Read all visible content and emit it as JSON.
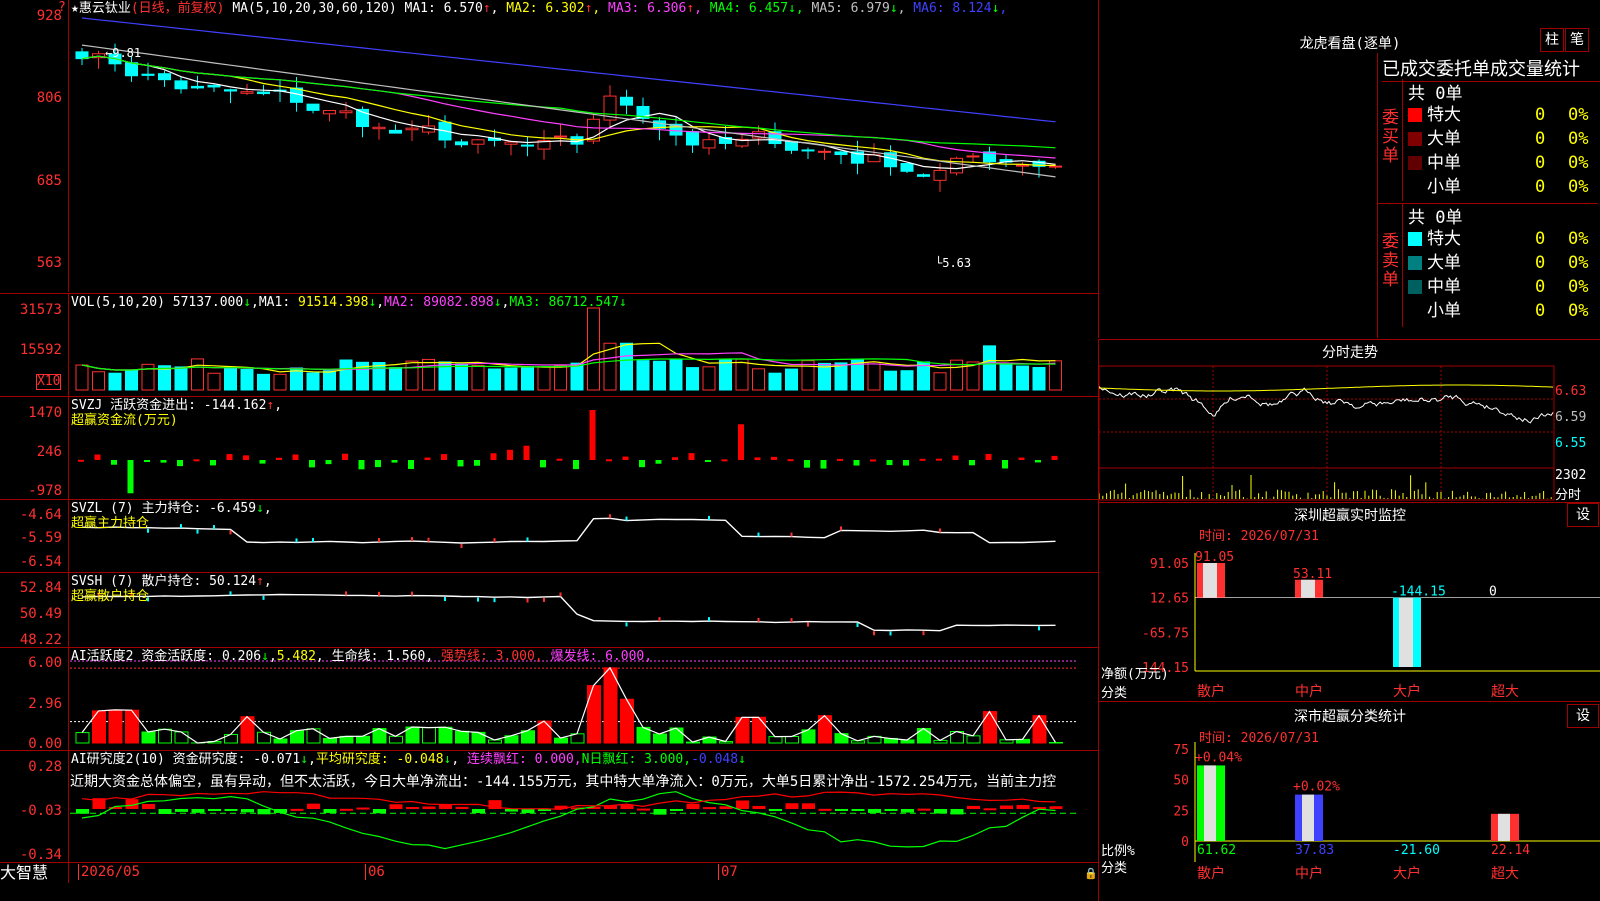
{
  "stock": {
    "name": "惠云钛业",
    "mode": "(日线，前复权)",
    "ma_label": "MA(5,10,20,30,60,120)",
    "ma": [
      {
        "name": "MA1",
        "value": "6.570",
        "arrow": "↑",
        "color": "#ffffff"
      },
      {
        "name": "MA2",
        "value": "6.302",
        "arrow": "↑",
        "color": "#ffff00"
      },
      {
        "name": "MA3",
        "value": "6.306",
        "arrow": "↑",
        "color": "#ff40ff"
      },
      {
        "name": "MA4",
        "value": "6.457",
        "arrow": "↓",
        "color": "#00ff00"
      },
      {
        "name": "MA5",
        "value": "6.979",
        "arrow": "↓",
        "color": "#c0c0c0"
      },
      {
        "name": "MA6",
        "value": "8.124",
        "arrow": "↓",
        "color": "#4040ff"
      }
    ],
    "price_axis": [
      "928",
      "806",
      "685",
      "563"
    ],
    "high_mark": "9.81",
    "low_mark": "5.63"
  },
  "vol": {
    "label": "VOL(5,10,20)",
    "value": "57137.000",
    "ma1": "91514.398",
    "ma2": "89082.898",
    "ma3": "86712.547",
    "axis": [
      "31573",
      "15592"
    ],
    "unit": "X10"
  },
  "svzj": {
    "label": "SVZJ  活跃资金进出:",
    "value": "-144.162",
    "sub": "超赢资金流(万元)",
    "axis": [
      "1470",
      "246",
      "-978"
    ]
  },
  "svzl": {
    "label": "SVZL (7) 主力持仓:",
    "value": "-6.459",
    "sub": "超赢主力持仓",
    "axis": [
      "-4.64",
      "-5.59",
      "-6.54"
    ]
  },
  "svsh": {
    "label": "SVSH (7) 散户持仓:",
    "value": "50.124",
    "sub": "超赢散户持仓",
    "axis": [
      "52.84",
      "50.49",
      "48.22"
    ]
  },
  "ai1": {
    "label": "AI活跃度2 资金活跃度:",
    "v1": "0.206",
    "v2": "5.482",
    "life": "生命线: 1.560,",
    "strong": "强势线: 3.000,",
    "burst": "爆发线: 6.000,",
    "axis": [
      "6.00",
      "2.96",
      "0.00"
    ]
  },
  "ai2": {
    "label": "AI研究度2(10) 资金研究度:",
    "v1": "-0.071",
    "avg": "平均研究度: -0.048",
    "lianxu": "连续飘红: 0.000,",
    "nday": "N日飘红: 3.000,",
    "last": "-0.048",
    "axis": [
      "0.28",
      "-0.03",
      "-0.34"
    ],
    "comment": "近期大资金总体偏空，虽有异动，但不太活跃，今日大单净流出：-144.155万元，其中特大单净流入：0万元，大单5日累计净出-1572.254万元，当前主力控"
  },
  "footer": {
    "brand": "大智慧",
    "dates": [
      "2026/05",
      "06",
      "07"
    ]
  },
  "longhu": {
    "title": "龙虎看盘(逐单)",
    "btn1": "柱",
    "btn2": "笔",
    "header": "已成交委托单成交量统计",
    "buy": {
      "side": "委买单",
      "total": "共 0单",
      "rows": [
        {
          "label": "特大",
          "n": "0",
          "p": "0%",
          "color": "#ff0000"
        },
        {
          "label": "大单",
          "n": "0",
          "p": "0%",
          "color": "#800000"
        },
        {
          "label": "中单",
          "n": "0",
          "p": "0%",
          "color": "#600000"
        },
        {
          "label": "小单",
          "n": "0",
          "p": "0%",
          "color": "#000000"
        }
      ]
    },
    "sell": {
      "side": "委卖单",
      "total": "共 0单",
      "rows": [
        {
          "label": "特大",
          "n": "0",
          "p": "0%",
          "color": "#00ffff"
        },
        {
          "label": "大单",
          "n": "0",
          "p": "0%",
          "color": "#008080"
        },
        {
          "label": "中单",
          "n": "0",
          "p": "0%",
          "color": "#006060"
        },
        {
          "label": "小单",
          "n": "0",
          "p": "0%",
          "color": "#000000"
        }
      ]
    }
  },
  "fenshi": {
    "title": "分时走势",
    "axis": [
      "6.63",
      "6.59",
      "6.55"
    ],
    "vol": "2302",
    "vol_label": "分时"
  },
  "monitor": {
    "title": "深圳超赢实时监控",
    "btn": "设",
    "time": "时间: 2026/07/31",
    "axis": [
      "91.05",
      "12.65",
      "-65.75",
      "-144.15"
    ],
    "bars": [
      {
        "cat": "散户",
        "val": "91.05",
        "color": "#ff3030"
      },
      {
        "cat": "中户",
        "val": "53.11",
        "color": "#ff3030"
      },
      {
        "cat": "大户",
        "val": "-144.15",
        "color": "#00ffff"
      },
      {
        "cat": "超大",
        "val": "0",
        "color": "#ffffff"
      }
    ],
    "ylabel": "净额(万元)",
    "xlabel": "分类"
  },
  "classify": {
    "title": "深市超赢分类统计",
    "btn": "设",
    "time": "时间: 2026/07/31",
    "axis": [
      "75",
      "50",
      "25",
      "0"
    ],
    "bars": [
      {
        "cat": "散户",
        "val": "61.62",
        "top": "+0.04%",
        "color": "#00ff00"
      },
      {
        "cat": "中户",
        "val": "37.83",
        "top": "+0.02%",
        "color": "#4040ff"
      },
      {
        "cat": "大户",
        "val": "-21.60",
        "top": "",
        "color": "#00ffff"
      },
      {
        "cat": "超大",
        "val": "22.14",
        "top": "",
        "color": "#ff3030"
      }
    ],
    "ylabel": "比例%",
    "xlabel": "分类"
  }
}
